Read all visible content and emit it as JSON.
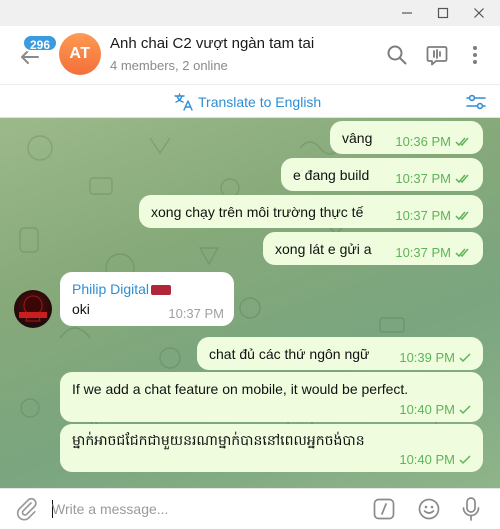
{
  "window": {
    "minimize_icon": "minimize-icon",
    "maximize_icon": "maximize-icon",
    "close_icon": "close-icon"
  },
  "header": {
    "unread_count": "296",
    "avatar_initials": "AT",
    "title": "Anh chai C2 vượt ngàn tam tai",
    "subtitle": "4 members, 2 online",
    "icons": [
      "search-icon",
      "voice-chat-icon",
      "more-icon"
    ]
  },
  "translate_bar": {
    "label": "Translate to English"
  },
  "messages": [
    {
      "text": "vâng",
      "time": "10:36 PM",
      "direction": "out",
      "status": "read"
    },
    {
      "text": "e đang build",
      "time": "10:37 PM",
      "direction": "out",
      "status": "read"
    },
    {
      "text": "xong chạy trên môi trường thực tế",
      "time": "10:37 PM",
      "direction": "out",
      "status": "read"
    },
    {
      "text": "xong lát e gửi a",
      "time": "10:37 PM",
      "direction": "out",
      "status": "read"
    },
    {
      "sender": "Philip Digital",
      "text": "oki",
      "time": "10:37 PM",
      "direction": "in"
    },
    {
      "text": "chat đủ các thứ ngôn ngữ",
      "time": "10:39 PM",
      "direction": "out",
      "status": "sent"
    },
    {
      "text": "If we add a chat feature on mobile, it would be perfect.",
      "time": "10:40 PM",
      "direction": "out",
      "status": "sent"
    },
    {
      "text": "ម្នាក់អាចជជែកជាមួយនរណាម្នាក់បាននៅពេលអ្នកចង់បាន",
      "time": "10:40 PM",
      "direction": "out",
      "status": "sent"
    }
  ],
  "input": {
    "placeholder": "Write a message..."
  },
  "colors": {
    "accent": "#2f8ed2",
    "badge": "#3a9be0",
    "outgoing_bubble": "#effdde",
    "check_green": "#5fb35a"
  }
}
